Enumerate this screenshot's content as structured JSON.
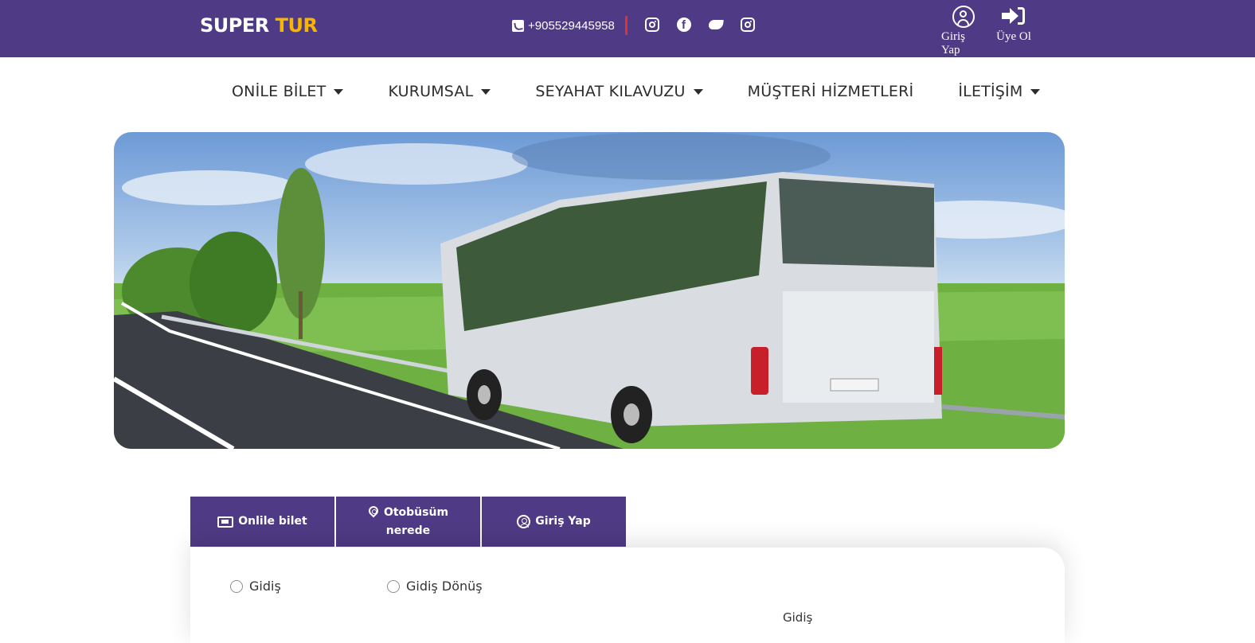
{
  "header": {
    "logo_main": "SUPER",
    "logo_accent": "TUR",
    "phone": "+905529445958",
    "socials": [
      "instagram-icon",
      "facebook-icon",
      "twitter-icon",
      "instagram-icon"
    ],
    "login_label": "Giriş Yap",
    "register_label": "Üye Ol"
  },
  "nav": {
    "items": [
      {
        "label": "ONİLE BİLET",
        "dropdown": true
      },
      {
        "label": "KURUMSAL",
        "dropdown": true
      },
      {
        "label": "SEYAHAT KILAVUZU",
        "dropdown": true
      },
      {
        "label": "MÜŞTERİ HİZMETLERİ",
        "dropdown": false
      },
      {
        "label": "İLETİŞİM",
        "dropdown": true
      }
    ]
  },
  "tabs": {
    "online_ticket": "Onlile bilet",
    "where_bus_line1": "Otobüsüm",
    "where_bus_line2": "nerede",
    "login": "Giriş Yap"
  },
  "form": {
    "trip_one_way": "Gidiş",
    "trip_round": "Gidiş Dönüş",
    "departure_label": "Gidiş"
  },
  "colors": {
    "brand": "#4f3a85",
    "accent": "#f7b500",
    "separator": "#e0302f"
  }
}
